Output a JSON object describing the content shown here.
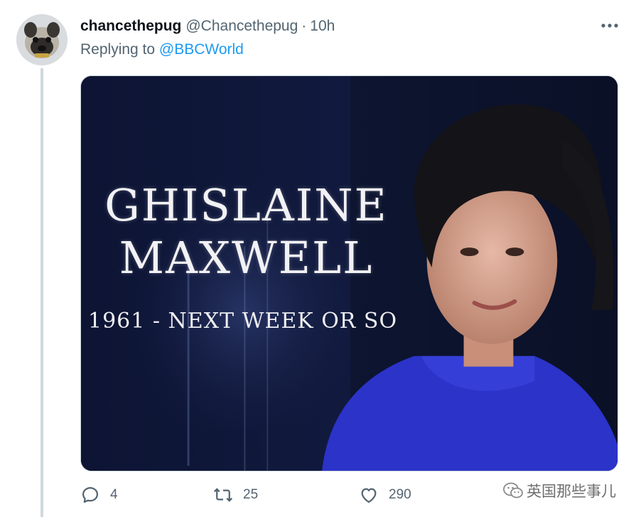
{
  "tweet": {
    "display_name": "chancethepug",
    "handle": "@Chancethepug",
    "separator": "·",
    "time": "10h",
    "replying_prefix": "Replying to",
    "replying_to": "@BBCWorld",
    "media": {
      "headline_line1": "GHISLAINE",
      "headline_line2": "MAXWELL",
      "dates": "1961 - NEXT WEEK OR SO"
    },
    "actions": {
      "replies": "4",
      "retweets": "25",
      "likes": "290"
    }
  },
  "icons": {
    "more": "more-horizontal-icon",
    "reply": "reply-bubble-icon",
    "retweet": "retweet-icon",
    "like": "heart-icon",
    "share": "share-icon",
    "watermark": "wechat-logo-icon"
  },
  "watermark": {
    "text": "英国那些事儿"
  },
  "colors": {
    "text_primary": "#0f1419",
    "text_secondary": "#536471",
    "link": "#1d9bf0",
    "thread_line": "#cfd9de"
  }
}
